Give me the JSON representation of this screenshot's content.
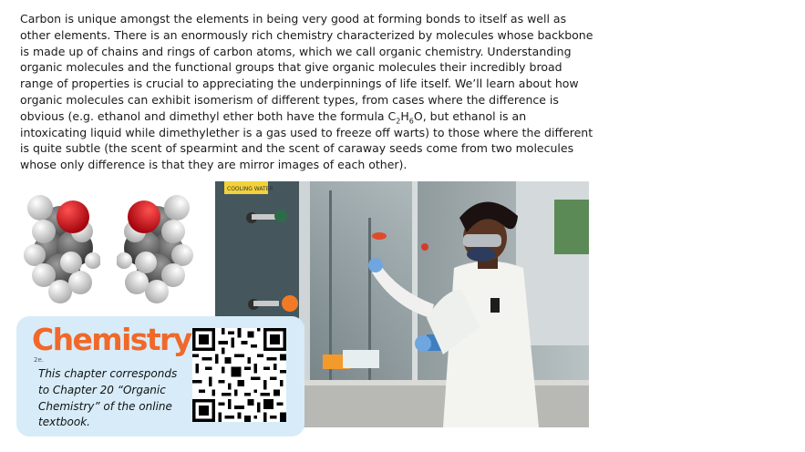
{
  "intro": {
    "text_1": "Carbon is unique amongst the elements in being very good at forming bonds to itself as well as other elements. There is an enormously rich chemistry characterized by molecules whose backbone is made up of chains and rings of carbon atoms, which we call organic chemistry. Understanding organic molecules and the functional groups that give organic molecules their incredibly broad range of properties is crucial to appreciating the underpinnings of life itself. We’ll learn about how organic molecules can exhibit isomerism of different types, from cases where the difference is obvious (e.g. ethanol and dimethyl ether both have the formula C",
    "sub_2": "2",
    "h": "H",
    "sub_6": "6",
    "text_2": "O, but ethanol is an intoxicating liquid while dimethylether is a gas used to freeze off warts) to those where the different is quite subtle (the scent of spearmint and the scent of caraway seeds come from two molecules whose only difference is that they are mirror images of each other)."
  },
  "photo": {
    "sign_text": "COOLING WATER"
  },
  "card": {
    "brand": "Chemistry",
    "edition": "2e.",
    "text": "This chapter corresponds to Chapter 20 “Organic Chemistry” of the online textbook."
  },
  "colors": {
    "brand_orange": "#f0682a",
    "card_bg": "#d7ecf8",
    "oxygen_red": "#d10f16"
  }
}
